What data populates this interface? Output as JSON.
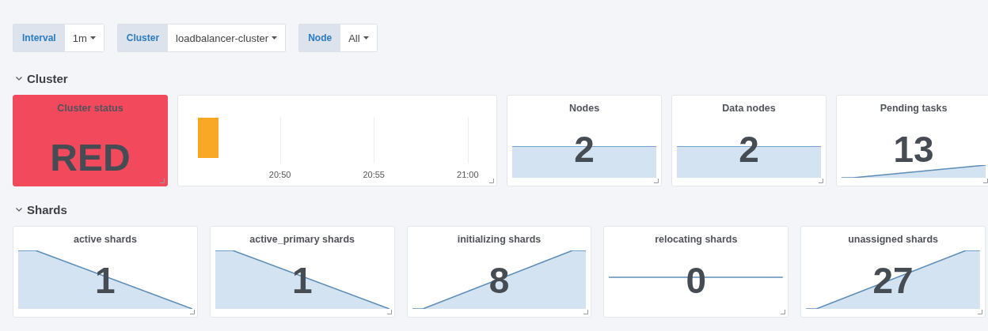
{
  "variables": [
    {
      "label": "Interval",
      "value": "1m"
    },
    {
      "label": "Cluster",
      "value": "loadbalancer-cluster"
    },
    {
      "label": "Node",
      "value": "All"
    }
  ],
  "sections": [
    {
      "title": "Cluster",
      "expanded": true,
      "panels": [
        {
          "kind": "status",
          "title": "Cluster status",
          "value": "RED"
        },
        {
          "kind": "timeline",
          "x_labels": [
            "20:50",
            "20:55",
            "21:00"
          ]
        },
        {
          "kind": "stat",
          "title": "Nodes",
          "value": "2",
          "sparkline": {
            "kind": "flat"
          }
        },
        {
          "kind": "stat",
          "title": "Data nodes",
          "value": "2",
          "sparkline": {
            "kind": "flat"
          }
        },
        {
          "kind": "stat",
          "title": "Pending tasks",
          "value": "13",
          "sparkline": {
            "kind": "slope"
          }
        }
      ]
    },
    {
      "title": "Shards",
      "expanded": true,
      "panels": [
        {
          "kind": "stat",
          "title": "active shards",
          "value": "1",
          "sparkline": {
            "kind": "fall"
          }
        },
        {
          "kind": "stat",
          "title": "active_primary shards",
          "value": "1",
          "sparkline": {
            "kind": "fall"
          }
        },
        {
          "kind": "stat",
          "title": "initializing shards",
          "value": "8",
          "sparkline": {
            "kind": "rise"
          }
        },
        {
          "kind": "stat",
          "title": "relocating shards",
          "value": "0",
          "sparkline": {
            "kind": "line"
          }
        },
        {
          "kind": "stat",
          "title": "unassigned shards",
          "value": "27",
          "sparkline": {
            "kind": "rise"
          }
        }
      ]
    }
  ]
}
